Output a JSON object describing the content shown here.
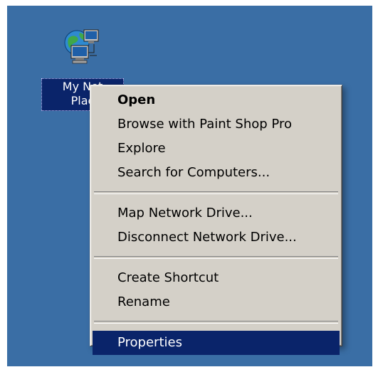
{
  "desktop": {
    "background_color": "#3a6ea5",
    "icon": {
      "name": "network-places-icon",
      "label_line1": "My Net",
      "label_line2": "Plac"
    }
  },
  "context_menu": {
    "selected_color": "#0a246a",
    "groups": [
      [
        "Open",
        "Browse with Paint Shop Pro",
        "Explore",
        "Search for Computers..."
      ],
      [
        "Map Network Drive...",
        "Disconnect Network Drive..."
      ],
      [
        "Create Shortcut",
        "Rename"
      ],
      [
        "Properties"
      ]
    ],
    "items": {
      "open": "Open",
      "browse_psp": "Browse with Paint Shop Pro",
      "explore": "Explore",
      "search_computers": "Search for Computers...",
      "map_drive": "Map Network Drive...",
      "disconnect_drive": "Disconnect Network Drive...",
      "create_shortcut": "Create Shortcut",
      "rename": "Rename",
      "properties": "Properties"
    },
    "default_item": "Open",
    "highlighted_item": "Properties"
  }
}
